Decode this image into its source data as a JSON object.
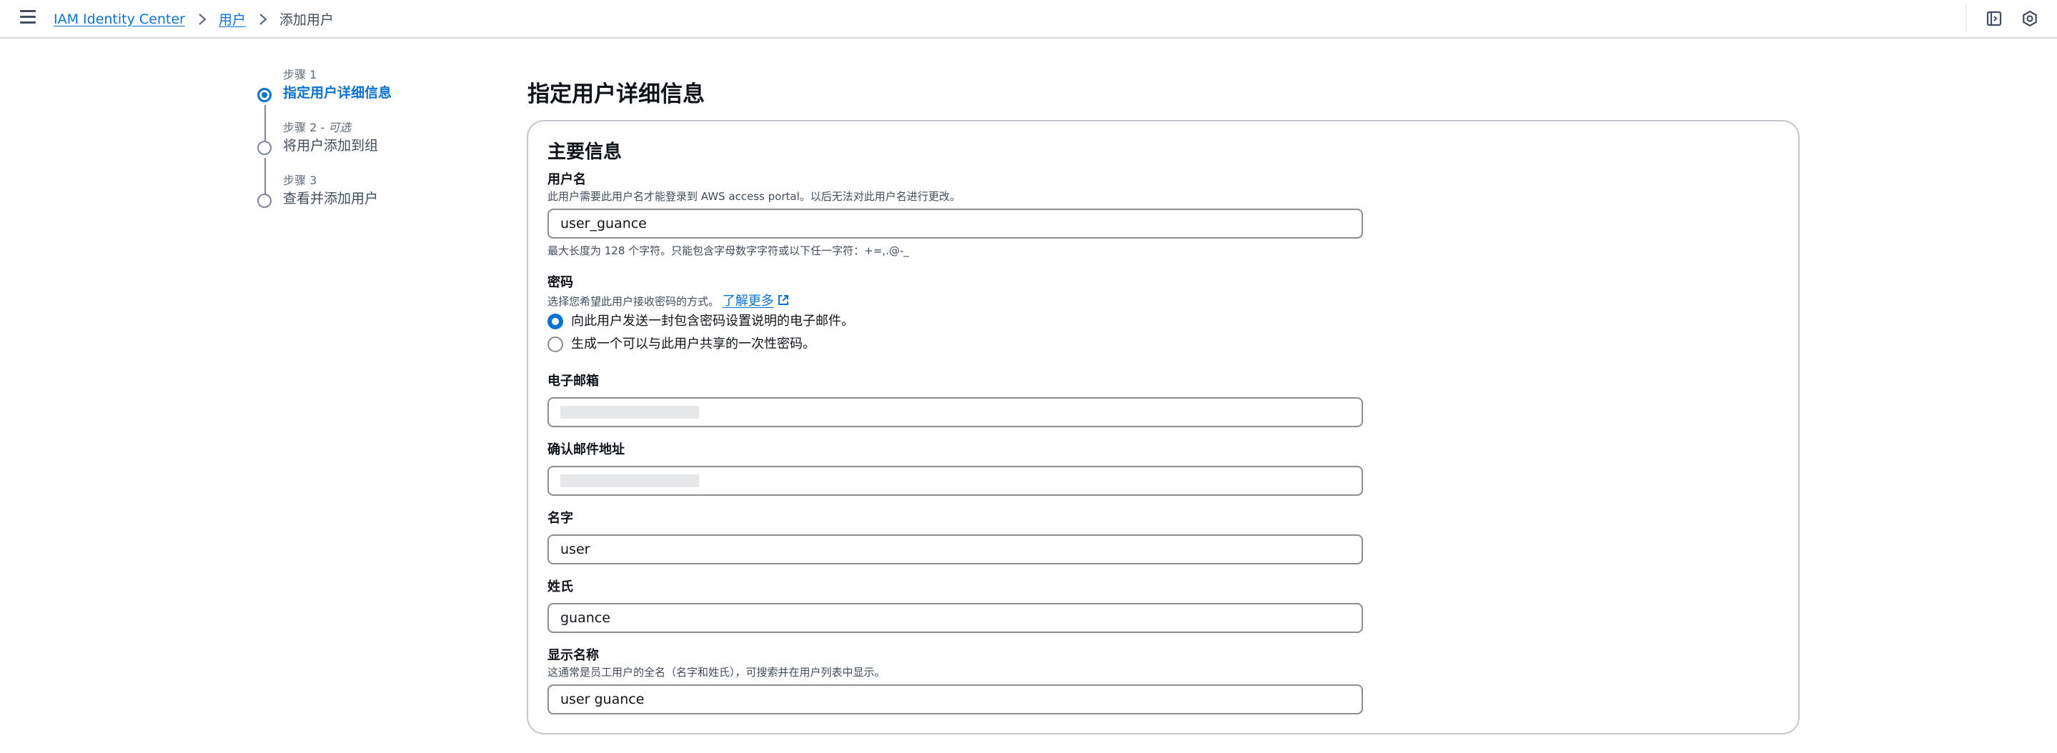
{
  "breadcrumb": {
    "items": [
      "IAM Identity Center",
      "用户"
    ],
    "current": "添加用户"
  },
  "steps": [
    {
      "number": "步骤 1",
      "title": "指定用户详细信息",
      "active": true
    },
    {
      "number": "步骤 2 - ",
      "optional": "可选",
      "title": "将用户添加到组",
      "active": false
    },
    {
      "number": "步骤 3",
      "title": "查看并添加用户",
      "active": false
    }
  ],
  "page_title": "指定用户详细信息",
  "panel_title": "主要信息",
  "username": {
    "label": "用户名",
    "description": "此用户需要此用户名才能登录到 AWS access portal。以后无法对此用户名进行更改。",
    "value": "user_guance",
    "hint": "最大长度为 128 个字符。只能包含字母数字字符或以下任一字符：+=,.@-_"
  },
  "password": {
    "label": "密码",
    "description": "选择您希望此用户接收密码的方式。",
    "learn_more": "了解更多",
    "options": [
      {
        "label": "向此用户发送一封包含密码设置说明的电子邮件。",
        "checked": true
      },
      {
        "label": "生成一个可以与此用户共享的一次性密码。",
        "checked": false
      }
    ]
  },
  "email": {
    "label": "电子邮箱"
  },
  "confirm_email": {
    "label": "确认邮件地址"
  },
  "first_name": {
    "label": "名字",
    "value": "user"
  },
  "last_name": {
    "label": "姓氏",
    "value": "guance"
  },
  "display_name": {
    "label": "显示名称",
    "description": "这通常是员工用户的全名（名字和姓氏），可搜索并在用户列表中显示。",
    "value": "user guance"
  },
  "colors": {
    "accent": "#0972d3",
    "border": "#8c8c94",
    "text": "#0f141a"
  }
}
